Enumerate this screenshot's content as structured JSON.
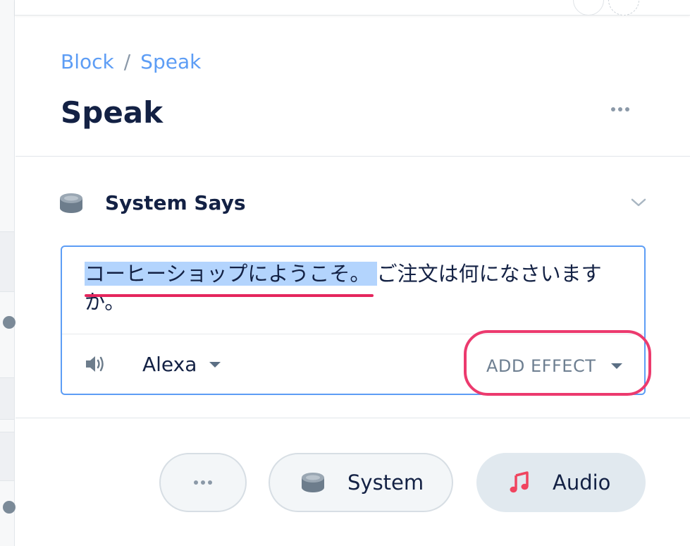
{
  "breadcrumb": {
    "parent": "Block",
    "separator": "/",
    "current": "Speak"
  },
  "page": {
    "title": "Speak"
  },
  "section": {
    "title": "System Says",
    "icon": "echo-device-icon",
    "toggle_icon": "chevron-down-icon"
  },
  "editor": {
    "highlighted_text": "コーヒーショップにようこそ。",
    "rest_text": "ご注文は何になさいますか。",
    "voice": "Alexa",
    "voice_icon": "speaker-icon",
    "add_effect_label": "ADD EFFECT"
  },
  "footer": {
    "more_icon": "ellipsis-icon",
    "system_label": "System",
    "system_icon": "echo-device-icon",
    "audio_label": "Audio",
    "audio_icon": "music-note-icon"
  },
  "colors": {
    "link": "#5d9df5",
    "heading": "#132144",
    "highlight": "#b3d4fd",
    "annotation": "#ec3a6e",
    "audio_icon": "#f0445f"
  }
}
